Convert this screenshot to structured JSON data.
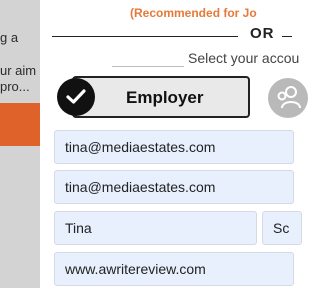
{
  "left_panel": {
    "line1": "g a",
    "line2": "ur aim",
    "line3": "pro..."
  },
  "signup": {
    "recommended_text": "(Recommended for Jo",
    "or_text": "OR",
    "select_text": "Select your accou",
    "employer_label": "Employer",
    "email": "tina@mediaestates.com",
    "email_confirm": "tina@mediaestates.com",
    "first_name": "Tina",
    "last_name_partial": "Sc",
    "website": "www.awritereview.com"
  },
  "colors": {
    "accent_orange": "#e0622b",
    "recommended": "#e57a3a",
    "autofill_bg": "#e8f0fe"
  }
}
